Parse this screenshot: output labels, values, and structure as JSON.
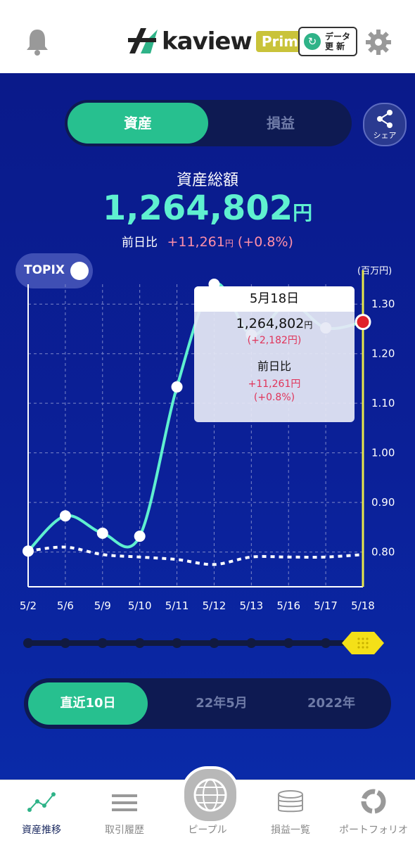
{
  "header": {
    "logo_text": "kaview",
    "logo_badge": "Prime",
    "data_button": [
      "データ",
      "更 新"
    ],
    "icons": {
      "left": "bell-icon",
      "right": "gear-icon"
    }
  },
  "tabs": {
    "active": "資産",
    "inactive": "損益"
  },
  "share_label": "シェア",
  "summary": {
    "label": "資産総額",
    "value": "1,264,802",
    "unit": "円",
    "diff_label": "前日比",
    "diff_value": "+11,261",
    "diff_unit": "円",
    "diff_pct": "(+0.8%)"
  },
  "topix_label": "TOPIX",
  "axis_unit": "(百万円)",
  "chart_data": {
    "type": "line",
    "x": [
      "5/2",
      "5/6",
      "5/9",
      "5/10",
      "5/11",
      "5/12",
      "5/13",
      "5/16",
      "5/17",
      "5/18"
    ],
    "yticks": [
      1.3,
      1.2,
      1.1,
      1.0,
      0.9,
      0.8
    ],
    "ylim": [
      0.73,
      1.34
    ],
    "series": [
      {
        "name": "資産",
        "values": [
          0.802,
          0.873,
          0.838,
          0.832,
          1.133,
          1.34,
          1.238,
          1.302,
          1.252,
          1.264
        ]
      },
      {
        "name": "TOPIX",
        "values": [
          0.802,
          0.81,
          0.795,
          0.79,
          0.785,
          0.775,
          0.79,
          0.79,
          0.79,
          0.795
        ]
      }
    ],
    "colors": {
      "asset": "#5ff0d0",
      "topix": "#ffffff",
      "marker": "#e0202a",
      "cursor": "#e8e84a"
    }
  },
  "tooltip": {
    "date": "5月18日",
    "value": "1,264,802",
    "unit": "円",
    "sub": "(+2,182円)",
    "diff_label": "前日比",
    "diff_value": "+11,261円",
    "diff_pct": "(+0.8%)"
  },
  "periods": [
    "直近10日",
    "22年5月",
    "2022年"
  ],
  "bottom_nav": [
    {
      "label": "資産推移",
      "icon": "line-chart-icon"
    },
    {
      "label": "取引履歴",
      "icon": "list-icon"
    },
    {
      "label": "ピープル",
      "icon": "globe-icon"
    },
    {
      "label": "損益一覧",
      "icon": "stack-icon"
    },
    {
      "label": "ポートフォリオ",
      "icon": "pie-icon"
    }
  ]
}
